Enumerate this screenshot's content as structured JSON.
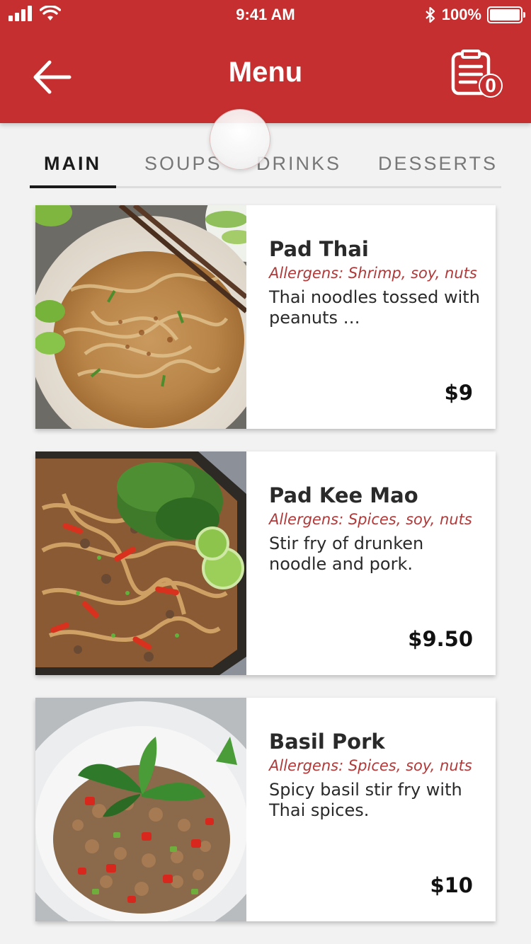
{
  "status_bar": {
    "time": "9:41 AM",
    "battery_text": "100%",
    "battery_level": 1.0
  },
  "header": {
    "title": "Menu",
    "order_count": "0"
  },
  "tabs": [
    {
      "label": "MAIN",
      "active": true
    },
    {
      "label": "SOUPS",
      "active": false
    },
    {
      "label": "DRINKS",
      "active": false
    },
    {
      "label": "DESSERTS",
      "active": false
    }
  ],
  "items": [
    {
      "name": "Pad Thai",
      "allergens": "Allergens: Shrimp, soy, nuts",
      "description": "Thai noodles tossed with peanuts …",
      "price": "$9"
    },
    {
      "name": "Pad Kee Mao",
      "allergens": "Allergens: Spices, soy, nuts",
      "description": "Stir fry of drunken noodle and pork.",
      "price": "$9.50"
    },
    {
      "name": "Basil Pork",
      "allergens": "Allergens: Spices, soy, nuts",
      "description": "Spicy basil stir fry with Thai spices.",
      "price": "$10"
    }
  ],
  "colors": {
    "brand": "#c62f2f",
    "allergen_text": "#b03a3a",
    "background": "#f2f2f2"
  }
}
